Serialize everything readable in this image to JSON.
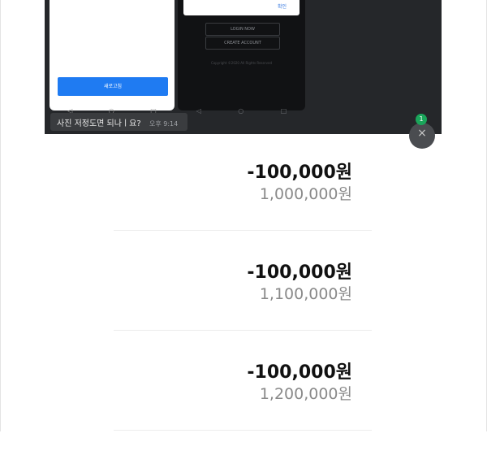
{
  "preview": {
    "left_phone": {
      "button_label": "새로고침"
    },
    "right_phone": {
      "dialog_ok": "확인",
      "login_label": "LOGIN NOW",
      "create_label": "CREATE ACCOUNT",
      "copyright": "Copyright ©2020 All Rights Reserved"
    },
    "nav": {
      "back": "◁",
      "home": "○",
      "recent": "□"
    }
  },
  "chat": {
    "message": "사진 저정도면 되나ㅣ요?",
    "time": "오후 9:14",
    "badge_count": "1",
    "close_glyph": "×"
  },
  "transactions": [
    {
      "amount": "-100,000원",
      "balance": "1,000,000원"
    },
    {
      "amount": "-100,000원",
      "balance": "1,100,000원"
    },
    {
      "amount": "-100,000원",
      "balance": "1,200,000원"
    }
  ]
}
